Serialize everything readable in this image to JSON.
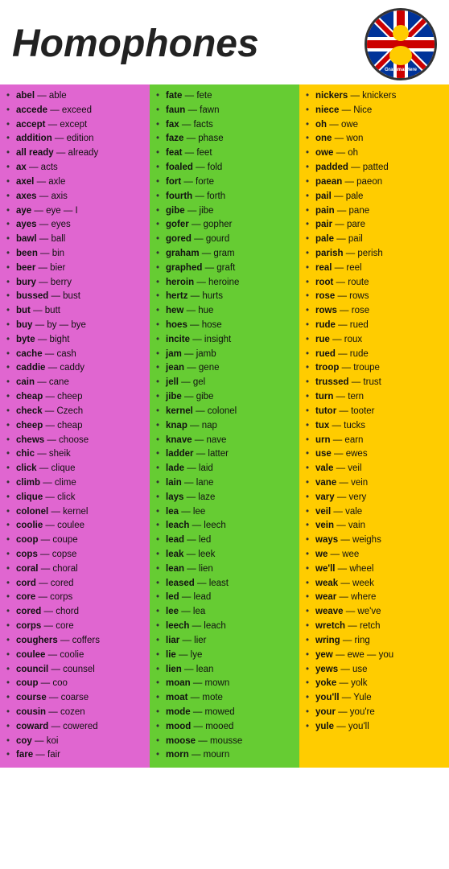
{
  "header": {
    "title": "Homophones",
    "logo_alt": "English Grammar Here"
  },
  "columns": [
    {
      "id": "col1",
      "bg": "#e066d0",
      "items": [
        {
          "bold": "abel",
          "rest": "— able"
        },
        {
          "bold": "accede",
          "rest": "— exceed"
        },
        {
          "bold": "accept",
          "rest": "— except"
        },
        {
          "bold": "addition",
          "rest": "— edition"
        },
        {
          "bold": "all ready",
          "rest": "— already"
        },
        {
          "bold": "ax",
          "rest": "— acts"
        },
        {
          "bold": "axel",
          "rest": "— axle"
        },
        {
          "bold": "axes",
          "rest": "— axis"
        },
        {
          "bold": "aye",
          "rest": "— eye — I"
        },
        {
          "bold": "ayes",
          "rest": "— eyes"
        },
        {
          "bold": "bawl",
          "rest": "— ball"
        },
        {
          "bold": "been",
          "rest": "— bin"
        },
        {
          "bold": "beer",
          "rest": "— bier"
        },
        {
          "bold": "bury",
          "rest": "— berry"
        },
        {
          "bold": "bussed",
          "rest": "— bust"
        },
        {
          "bold": "but",
          "rest": "— butt"
        },
        {
          "bold": "buy",
          "rest": "— by — bye"
        },
        {
          "bold": "byte",
          "rest": "— bight"
        },
        {
          "bold": "cache",
          "rest": "— cash"
        },
        {
          "bold": "caddie",
          "rest": "— caddy"
        },
        {
          "bold": "cain",
          "rest": "— cane"
        },
        {
          "bold": "cheap",
          "rest": "— cheep"
        },
        {
          "bold": "check",
          "rest": "— Czech"
        },
        {
          "bold": "cheep",
          "rest": "— cheap"
        },
        {
          "bold": "chews",
          "rest": "— choose"
        },
        {
          "bold": "chic",
          "rest": "— sheik"
        },
        {
          "bold": "click",
          "rest": "— clique"
        },
        {
          "bold": "climb",
          "rest": "— clime"
        },
        {
          "bold": "clique",
          "rest": "— click"
        },
        {
          "bold": "colonel",
          "rest": "— kernel"
        },
        {
          "bold": "coolie",
          "rest": "— coulee"
        },
        {
          "bold": "coop",
          "rest": "— coupe"
        },
        {
          "bold": "cops",
          "rest": "— copse"
        },
        {
          "bold": "coral",
          "rest": "— choral"
        },
        {
          "bold": "cord",
          "rest": "— cored"
        },
        {
          "bold": "core",
          "rest": "— corps"
        },
        {
          "bold": "cored",
          "rest": "— chord"
        },
        {
          "bold": "corps",
          "rest": "— core"
        },
        {
          "bold": "coughers",
          "rest": "— coffers"
        },
        {
          "bold": "coulee",
          "rest": "— coolie"
        },
        {
          "bold": "council",
          "rest": "— counsel"
        },
        {
          "bold": "coup",
          "rest": "— coo"
        },
        {
          "bold": "course",
          "rest": "— coarse"
        },
        {
          "bold": "cousin",
          "rest": "— cozen"
        },
        {
          "bold": "coward",
          "rest": "— cowered"
        },
        {
          "bold": "coy",
          "rest": "— koi"
        },
        {
          "bold": "fare",
          "rest": "— fair"
        }
      ]
    },
    {
      "id": "col2",
      "bg": "#66cc33",
      "items": [
        {
          "bold": "fate",
          "rest": "— fete"
        },
        {
          "bold": "faun",
          "rest": "— fawn"
        },
        {
          "bold": "fax",
          "rest": "— facts"
        },
        {
          "bold": "faze",
          "rest": "— phase"
        },
        {
          "bold": "feat",
          "rest": "— feet"
        },
        {
          "bold": "foaled",
          "rest": "— fold"
        },
        {
          "bold": "fort",
          "rest": "— forte"
        },
        {
          "bold": "fourth",
          "rest": "— forth"
        },
        {
          "bold": "gibe",
          "rest": "— jibe"
        },
        {
          "bold": "gofer",
          "rest": "— gopher"
        },
        {
          "bold": "gored",
          "rest": "— gourd"
        },
        {
          "bold": "graham",
          "rest": "— gram"
        },
        {
          "bold": "graphed",
          "rest": "— graft"
        },
        {
          "bold": "heroin",
          "rest": "— heroine"
        },
        {
          "bold": "hertz",
          "rest": "— hurts"
        },
        {
          "bold": "hew",
          "rest": "— hue"
        },
        {
          "bold": "hoes",
          "rest": "— hose"
        },
        {
          "bold": "incite",
          "rest": "— insight"
        },
        {
          "bold": "jam",
          "rest": "— jamb"
        },
        {
          "bold": "jean",
          "rest": "— gene"
        },
        {
          "bold": "jell",
          "rest": "— gel"
        },
        {
          "bold": "jibe",
          "rest": "— gibe"
        },
        {
          "bold": "kernel",
          "rest": "— colonel"
        },
        {
          "bold": "knap",
          "rest": "— nap"
        },
        {
          "bold": "knave",
          "rest": "— nave"
        },
        {
          "bold": "ladder",
          "rest": "— latter"
        },
        {
          "bold": "lade",
          "rest": "— laid"
        },
        {
          "bold": "lain",
          "rest": "— lane"
        },
        {
          "bold": "lays",
          "rest": "— laze"
        },
        {
          "bold": "lea",
          "rest": "— lee"
        },
        {
          "bold": "leach",
          "rest": "— leech"
        },
        {
          "bold": "lead",
          "rest": "— led"
        },
        {
          "bold": "leak",
          "rest": "— leek"
        },
        {
          "bold": "lean",
          "rest": "— lien"
        },
        {
          "bold": "leased",
          "rest": "— least"
        },
        {
          "bold": "led",
          "rest": "— lead"
        },
        {
          "bold": "lee",
          "rest": "— lea"
        },
        {
          "bold": "leech",
          "rest": "— leach"
        },
        {
          "bold": "liar",
          "rest": "— lier"
        },
        {
          "bold": "lie",
          "rest": "— lye"
        },
        {
          "bold": "lien",
          "rest": "— lean"
        },
        {
          "bold": "moan",
          "rest": "— mown"
        },
        {
          "bold": "moat",
          "rest": "— mote"
        },
        {
          "bold": "mode",
          "rest": "— mowed"
        },
        {
          "bold": "mood",
          "rest": "— mooed"
        },
        {
          "bold": "moose",
          "rest": "— mousse"
        },
        {
          "bold": "morn",
          "rest": "— mourn"
        }
      ]
    },
    {
      "id": "col3",
      "bg": "#ffcc00",
      "items": [
        {
          "bold": "nickers",
          "rest": "— knickers"
        },
        {
          "bold": "niece",
          "rest": "— Nice"
        },
        {
          "bold": "oh",
          "rest": "— owe"
        },
        {
          "bold": "one",
          "rest": "— won"
        },
        {
          "bold": "owe",
          "rest": "— oh"
        },
        {
          "bold": "padded",
          "rest": "— patted"
        },
        {
          "bold": "paean",
          "rest": "— paeon"
        },
        {
          "bold": "pail",
          "rest": "— pale"
        },
        {
          "bold": "pain",
          "rest": "— pane"
        },
        {
          "bold": "pair",
          "rest": "— pare"
        },
        {
          "bold": "pale",
          "rest": "— pail"
        },
        {
          "bold": "parish",
          "rest": "— perish"
        },
        {
          "bold": "real",
          "rest": "— reel"
        },
        {
          "bold": "root",
          "rest": "— route"
        },
        {
          "bold": "rose",
          "rest": "— rows"
        },
        {
          "bold": "rows",
          "rest": "— rose"
        },
        {
          "bold": "rude",
          "rest": "— rued"
        },
        {
          "bold": "rue",
          "rest": "— roux"
        },
        {
          "bold": "rued",
          "rest": "— rude"
        },
        {
          "bold": "troop",
          "rest": "— troupe"
        },
        {
          "bold": "trussed",
          "rest": "— trust"
        },
        {
          "bold": "turn",
          "rest": "— tern"
        },
        {
          "bold": "tutor",
          "rest": "— tooter"
        },
        {
          "bold": "tux",
          "rest": "— tucks"
        },
        {
          "bold": "urn",
          "rest": "— earn"
        },
        {
          "bold": "use",
          "rest": "— ewes"
        },
        {
          "bold": "vale",
          "rest": "— veil"
        },
        {
          "bold": "vane",
          "rest": "— vein"
        },
        {
          "bold": "vary",
          "rest": "— very"
        },
        {
          "bold": "veil",
          "rest": "— vale"
        },
        {
          "bold": "vein",
          "rest": "— vain"
        },
        {
          "bold": "ways",
          "rest": "— weighs"
        },
        {
          "bold": "we",
          "rest": "— wee"
        },
        {
          "bold": "we'll",
          "rest": "— wheel"
        },
        {
          "bold": "weak",
          "rest": "— week"
        },
        {
          "bold": "wear",
          "rest": "— where"
        },
        {
          "bold": "weave",
          "rest": "— we've"
        },
        {
          "bold": "wretch",
          "rest": "— retch"
        },
        {
          "bold": "wring",
          "rest": "— ring"
        },
        {
          "bold": "yew",
          "rest": "— ewe — you"
        },
        {
          "bold": "yews",
          "rest": "— use"
        },
        {
          "bold": "yoke",
          "rest": "— yolk"
        },
        {
          "bold": "you'll",
          "rest": "— Yule"
        },
        {
          "bold": "your",
          "rest": "— you're"
        },
        {
          "bold": "yule",
          "rest": "— you'll"
        }
      ]
    }
  ]
}
